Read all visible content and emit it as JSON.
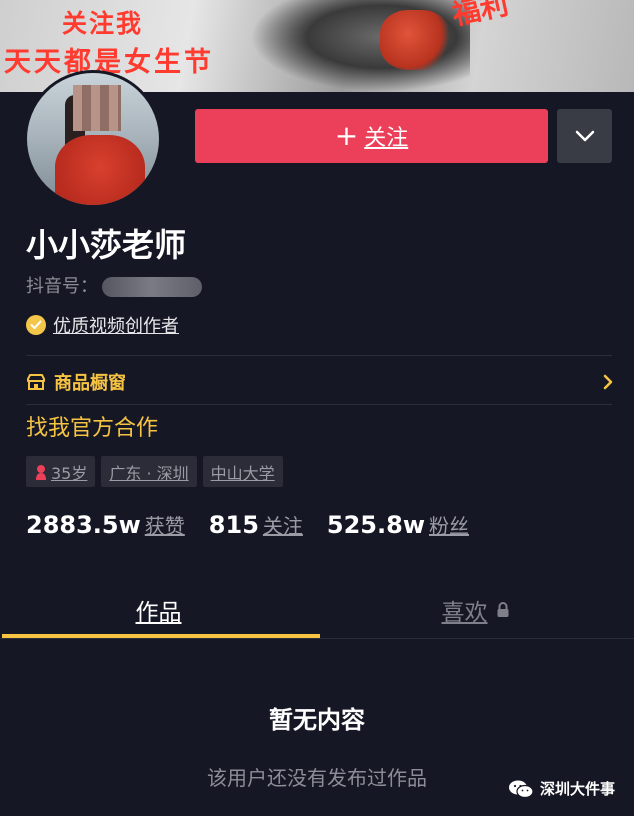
{
  "banner": {
    "line1": "关注我",
    "line2": "天天都是女生节",
    "corner": "福利"
  },
  "header": {
    "follow_label": "关注",
    "follow_plus": "+"
  },
  "profile": {
    "nickname": "小小莎老师",
    "douyin_id_label": "抖音号：",
    "certification": "优质视频创作者",
    "shop_window": "商品橱窗",
    "bio": "找我官方合作",
    "tags": {
      "age": "35岁",
      "location": "广东 · 深圳",
      "school": "中山大学"
    },
    "stats": {
      "likes_num": "2883.5w",
      "likes_label": "获赞",
      "following_num": "815",
      "following_label": "关注",
      "fans_num": "525.8w",
      "fans_label": "粉丝"
    }
  },
  "tabs": {
    "works": "作品",
    "likes": "喜欢"
  },
  "empty": {
    "title": "暂无内容",
    "subtitle": "该用户还没有发布过作品"
  },
  "watermark": {
    "text": "深圳大件事"
  },
  "colors": {
    "background": "#161724",
    "accent_follow": "#ec3f59",
    "accent_yellow": "#f6c342"
  },
  "icons": [
    "chevron-down-icon",
    "verified-badge-icon",
    "shop-icon",
    "chevron-right-icon",
    "female-icon",
    "lock-icon",
    "wechat-icon"
  ]
}
